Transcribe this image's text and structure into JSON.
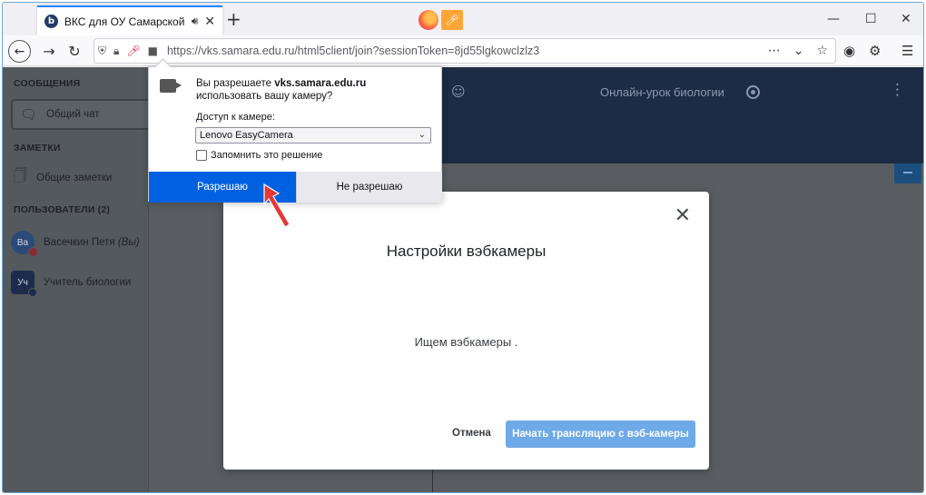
{
  "browser": {
    "tab_favicon": "b",
    "tab_title": "ВКС для ОУ Самарской об",
    "tab_audio_icon": "speaker-icon",
    "new_tab": "+",
    "url": "https://vks.samara.edu.ru/html5client/join?sessionToken=8jd55lgkowclzlz3",
    "window_controls": [
      "—",
      "☐",
      "✕"
    ]
  },
  "permission": {
    "question_prefix": "Вы разрешаете ",
    "domain": "vks.samara.edu.ru",
    "question_suffix": " использовать вашу камеру?",
    "access_label": "Доступ к камере:",
    "camera_selected": "Lenovo EasyCamera",
    "remember": "Запомнить это решение",
    "allow": "Разрешаю",
    "deny": "Не разрешаю"
  },
  "sidebar": {
    "messages_header": "СООБЩЕНИЯ",
    "public_chat": "Общий чат",
    "notes_header": "ЗАМЕТКИ",
    "shared_notes": "Общие заметки",
    "users_header": "ПОЛЬЗОВАТЕЛИ (2)",
    "users": [
      {
        "initials": "Ва",
        "name": "Васечкин Петя",
        "suffix": "(Вы)"
      },
      {
        "initials": "Уч",
        "name": "Учитель биологии",
        "suffix": ""
      }
    ]
  },
  "topbar": {
    "meeting_title": "Онлайн-урок биологии"
  },
  "webcam_modal": {
    "title": "Настройки вэбкамеры",
    "status": "Ищем вэбкамеры .",
    "cancel": "Отмена",
    "start": "Начать трансляцию с вэб-камеры"
  },
  "colors": {
    "allow_button": "#0061e0",
    "start_button": "#6ea9e8",
    "topbar": "#1c2c44",
    "arrow": "#e53935"
  }
}
